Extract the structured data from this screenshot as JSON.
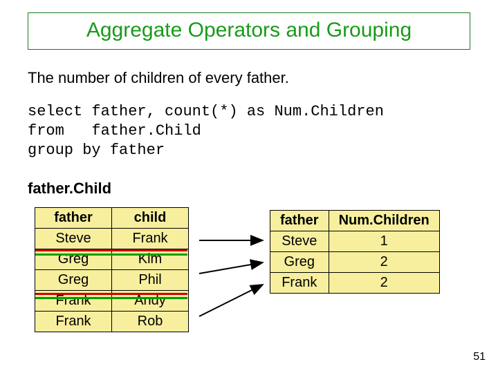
{
  "title": "Aggregate Operators and Grouping",
  "subtitle": "The number of children of every father.",
  "sql": {
    "line1a": "select ",
    "line1b": "father, count(*) as Num.Children",
    "line2a": "from   ",
    "line2b": "father.Child",
    "line3a": "group by ",
    "line3b": "father"
  },
  "leftTable": {
    "name": "father.Child",
    "headers": [
      "father",
      "child"
    ],
    "rows": [
      [
        "Steve",
        "Frank"
      ],
      [
        "Greg",
        "Kim"
      ],
      [
        "Greg",
        "Phil"
      ],
      [
        "Frank",
        "Andy"
      ],
      [
        "Frank",
        "Rob"
      ]
    ]
  },
  "rightTable": {
    "headers": [
      "father",
      "Num.Children"
    ],
    "rows": [
      [
        "Steve",
        "1"
      ],
      [
        "Greg",
        "2"
      ],
      [
        "Frank",
        "2"
      ]
    ]
  },
  "pageNumber": "51"
}
